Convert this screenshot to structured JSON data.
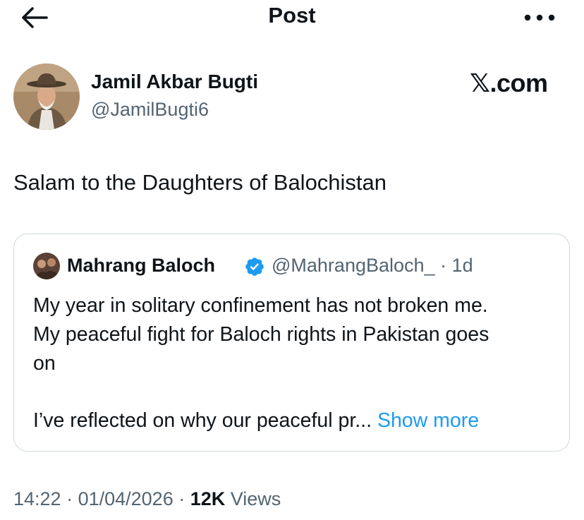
{
  "header": {
    "title": "Post",
    "back_icon": "arrow-left-icon",
    "more_icon": "more-horizontal-icon"
  },
  "author": {
    "name": "Jamil Akbar Bugti",
    "handle": "@JamilBugti6"
  },
  "brand": {
    "label": "𝕏.com"
  },
  "post": {
    "text": "Salam to the Daughters of Balochistan"
  },
  "quote": {
    "name": "Mahrang Baloch",
    "verified_icon": "verified-badge-icon",
    "handle": "@MahrangBaloch_",
    "separator": " · ",
    "time": "1d",
    "line1": "My year in solitary confinement has not broken me.",
    "line2": "My peaceful fight for Baloch rights in Pakistan goes",
    "line3": "on",
    "line4": "I’ve reflected on why our peaceful pr... ",
    "show_more": "Show more"
  },
  "footer": {
    "time": "14:22",
    "sep1": " · ",
    "date": "01/04/2026",
    "sep2": " · ",
    "views_count": "12K",
    "views_label": " Views"
  },
  "colors": {
    "text": "#0f1419",
    "secondary": "#536471",
    "link": "#1d9bf0",
    "verified": "#1d9bf0",
    "border": "#cfd9de"
  }
}
